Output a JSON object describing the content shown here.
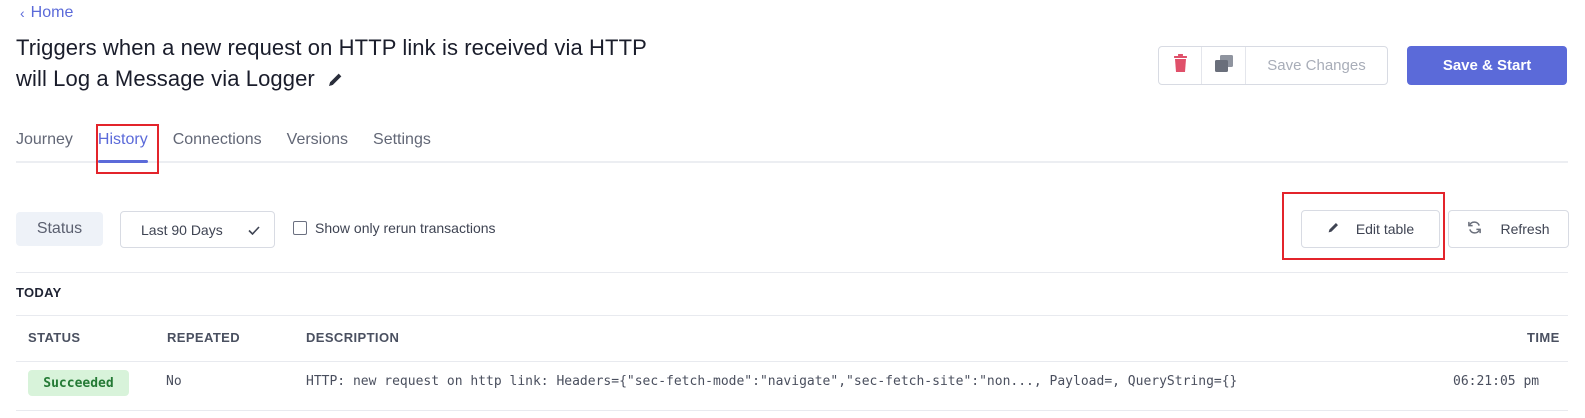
{
  "breadcrumb": {
    "back_label": "Home"
  },
  "title": "Triggers when a new request on HTTP link is received via HTTP will Log a Message via Logger",
  "toolbar": {
    "delete_icon": "trash-icon",
    "copy_icon": "copy-icon",
    "save_changes_label": "Save Changes",
    "save_start_label": "Save & Start"
  },
  "tabs": [
    {
      "label": "Journey",
      "active": false
    },
    {
      "label": "History",
      "active": true
    },
    {
      "label": "Connections",
      "active": false
    },
    {
      "label": "Versions",
      "active": false
    },
    {
      "label": "Settings",
      "active": false
    }
  ],
  "filters": {
    "status_label": "Status",
    "range_value": "Last 90 Days",
    "rerun_label": "Show only rerun transactions",
    "rerun_checked": false
  },
  "actions": {
    "edit_table_label": "Edit table",
    "refresh_label": "Refresh"
  },
  "history": {
    "group_label": "TODAY",
    "columns": {
      "status": "STATUS",
      "repeated": "REPEATED",
      "description": "DESCRIPTION",
      "time": "TIME"
    },
    "rows": [
      {
        "status": "Succeeded",
        "repeated": "No",
        "description": "HTTP: new request on http link: Headers={\"sec-fetch-mode\":\"navigate\",\"sec-fetch-site\":\"non..., Payload=, QueryString={}",
        "time": "06:21:05 pm"
      }
    ]
  },
  "colors": {
    "accent": "#5b6ad9",
    "danger": "#e0506a",
    "success_bg": "#d8f3da",
    "success_text": "#247a35",
    "annotation_red": "#e3242b"
  }
}
